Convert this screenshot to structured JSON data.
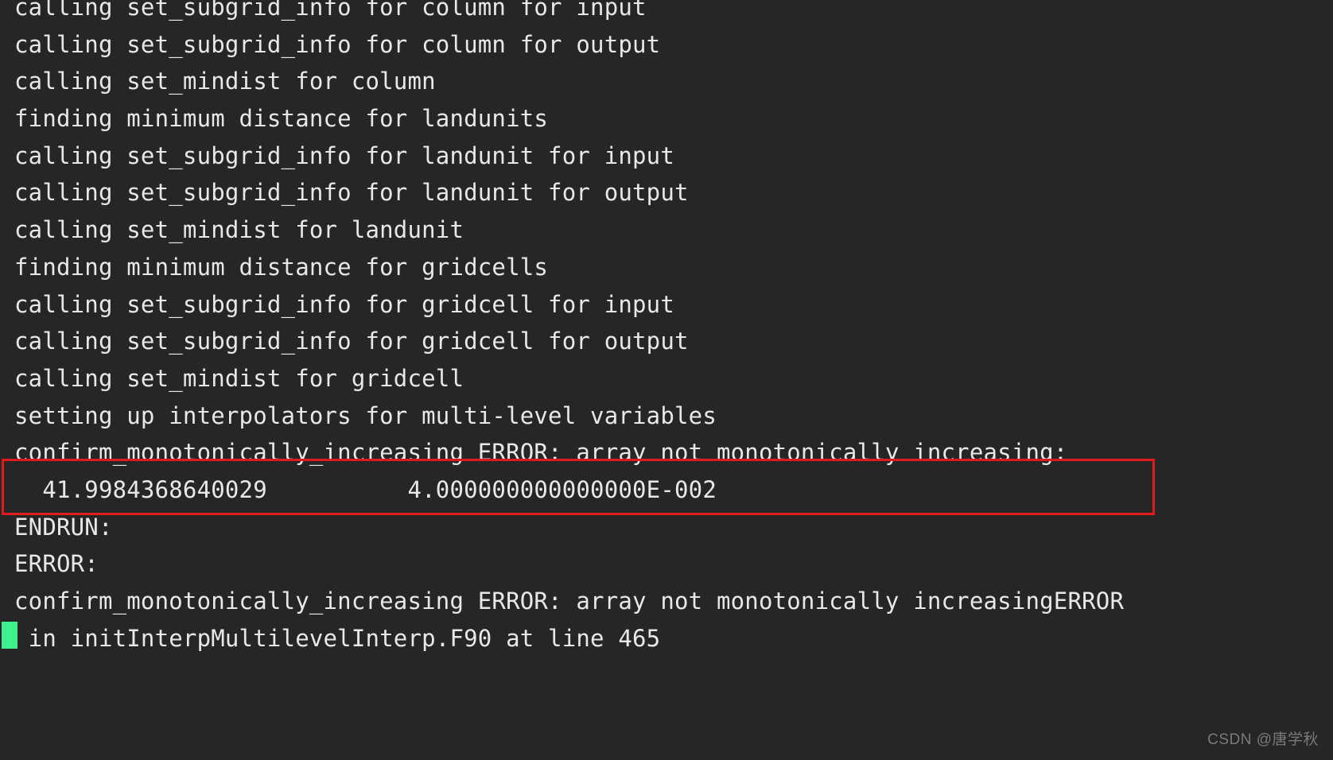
{
  "terminal": {
    "background_color": "#262626",
    "foreground_color": "#e8e8e8",
    "cursor_color": "#3ff08f",
    "highlight_color": "#e01b1b",
    "lines": [
      {
        "text": "calling set_subgrid_info for column for input",
        "clipped_top": true
      },
      {
        "text": "calling set_subgrid_info for column for output"
      },
      {
        "text": "calling set_mindist for column"
      },
      {
        "text": "finding minimum distance for landunits"
      },
      {
        "text": "calling set_subgrid_info for landunit for input"
      },
      {
        "text": "calling set_subgrid_info for landunit for output"
      },
      {
        "text": "calling set_mindist for landunit"
      },
      {
        "text": "finding minimum distance for gridcells"
      },
      {
        "text": "calling set_subgrid_info for gridcell for input"
      },
      {
        "text": "calling set_subgrid_info for gridcell for output"
      },
      {
        "text": "calling set_mindist for gridcell"
      },
      {
        "text": "setting up interpolators for multi-level variables"
      },
      {
        "text": "confirm_monotonically_increasing ERROR: array not monotonically increasing:",
        "highlighted": true
      },
      {
        "text": "  41.9984368640029          4.000000000000000E-002",
        "highlighted": true
      },
      {
        "text": "ENDRUN:"
      },
      {
        "text": "ERROR:"
      },
      {
        "text": "confirm_monotonically_increasing ERROR: array not monotonically increasingERROR"
      },
      {
        "text": " in initInterpMultilevelInterp.F90 at line 465"
      }
    ]
  },
  "error_values": {
    "first_value": "41.9984368640029",
    "second_value": "4.000000000000000E-002",
    "error_name": "confirm_monotonically_increasing",
    "error_message": "array not monotonically increasing:",
    "source_file": "initInterpMultilevelInterp.F90",
    "line_number": "465"
  },
  "watermark": {
    "text": "CSDN @唐学秋"
  }
}
